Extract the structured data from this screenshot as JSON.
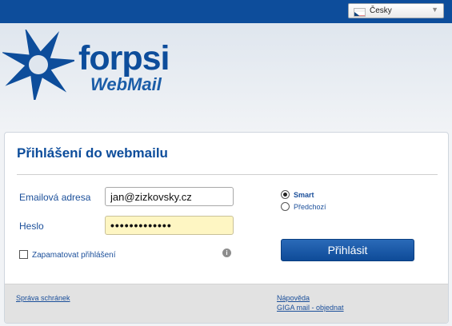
{
  "header": {
    "language": {
      "selected": "Česky",
      "flag_icon": "czech-flag-icon",
      "arrow_icon": "chevron-down-icon"
    },
    "bar_color": "#0d4d9b"
  },
  "logo": {
    "brand": "forpsi",
    "product": "WebMail",
    "mark_icon": "forpsi-star-logo-icon",
    "brand_color": "#0d4d9b"
  },
  "login": {
    "title": "Přihlášení do webmailu",
    "email_label": "Emailová adresa",
    "email_value": "jan@zizkovsky.cz",
    "password_label": "Heslo",
    "password_value": "•••••••••••••",
    "mode_options": [
      {
        "label": "Smart",
        "checked": true
      },
      {
        "label": "Předchozí",
        "checked": false
      }
    ],
    "remember_label": "Zapamatovat přihlášení",
    "info_icon": "info-icon",
    "submit_label": "Přihlásit"
  },
  "footer": {
    "left_link": "Správa schránek",
    "right_links": [
      "Nápověda",
      "GIGA mail - objednat"
    ]
  }
}
